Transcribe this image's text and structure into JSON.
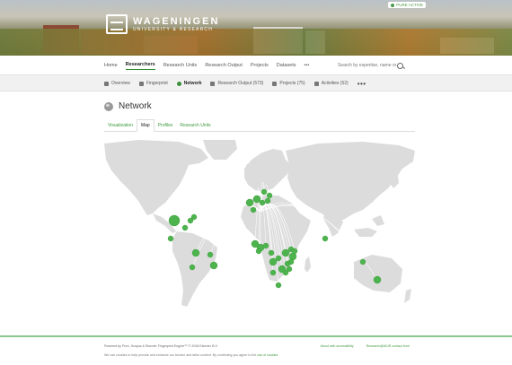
{
  "header": {
    "logo_line1": "WAGENINGEN",
    "logo_line2": "UNIVERSITY & RESEARCH",
    "pure_badge": "PURE ACTIVE"
  },
  "main_nav": {
    "items": [
      {
        "label": "Home"
      },
      {
        "label": "Researchers"
      },
      {
        "label": "Research Units"
      },
      {
        "label": "Research Output"
      },
      {
        "label": "Projects"
      },
      {
        "label": "Datasets"
      },
      {
        "label": "•••"
      }
    ],
    "active": "Researchers",
    "search_placeholder": "Search by expertise, name or"
  },
  "sub_nav": {
    "items": [
      {
        "label": "Overview",
        "icon": "person-icon"
      },
      {
        "label": "Fingerprint",
        "icon": "fingerprint-icon"
      },
      {
        "label": "Network",
        "icon": "network-icon"
      },
      {
        "label": "Research Output (573)",
        "icon": "book-icon"
      },
      {
        "label": "Projects (75)",
        "icon": "folder-icon"
      },
      {
        "label": "Activities (52)",
        "icon": "activity-icon"
      }
    ],
    "more": "•••",
    "active": "Network"
  },
  "page": {
    "title": "Network",
    "tabs": [
      {
        "label": "Visualization"
      },
      {
        "label": "Map"
      },
      {
        "label": "Profiles"
      },
      {
        "label": "Research Units"
      }
    ],
    "active_tab": "Map"
  },
  "map": {
    "land_color": "#dcdcdc",
    "marker_color": "#4db34d",
    "line_color": "#ffffff"
  },
  "footer": {
    "powered_by": "Powered by Pure, Scopus & Elsevier Fingerprint Engine™ © 2018 Elsevier B.V.",
    "link_about": "About web accessibility",
    "link_research": "Research@WUR contact form",
    "cookies_text": "We use cookies to help provide and enhance our service and tailor content. By continuing you agree to the",
    "cookies_link": "use of cookies"
  }
}
